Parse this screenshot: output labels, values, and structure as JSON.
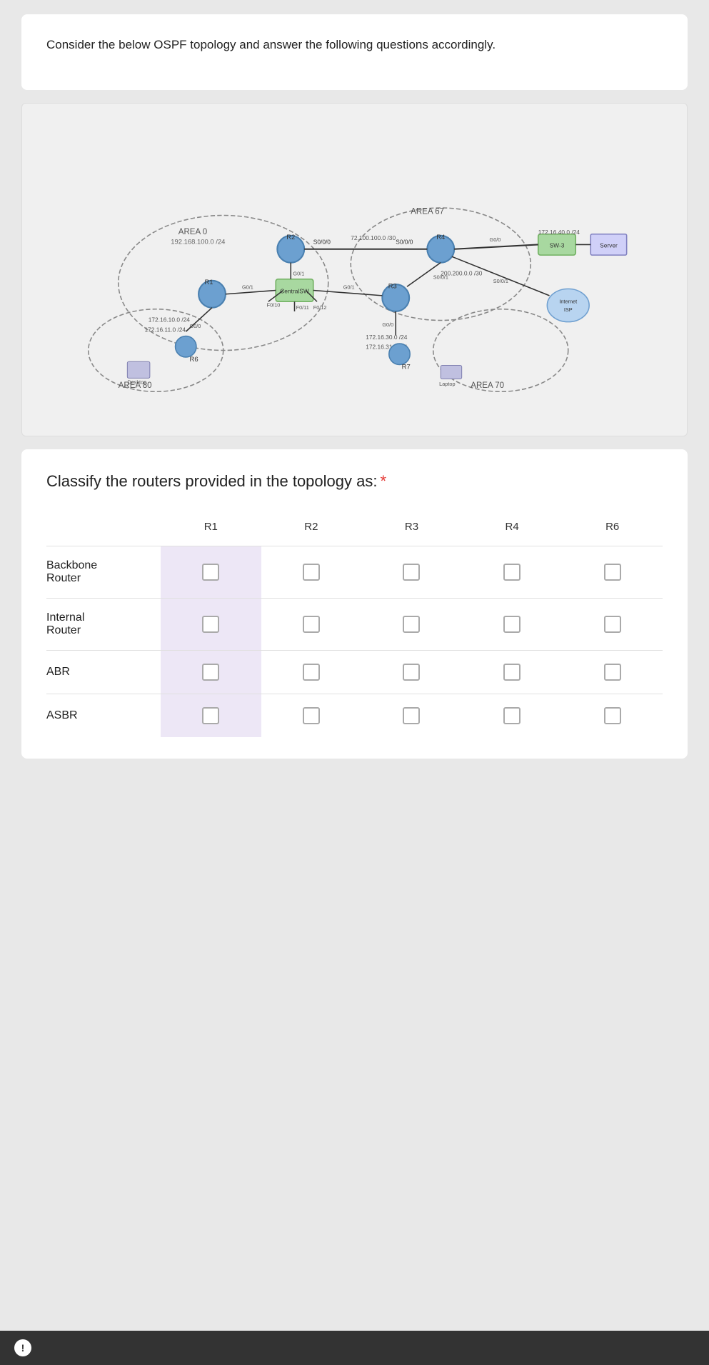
{
  "question": {
    "text": "Consider the below OSPF topology and answer the following questions accordingly.",
    "classify_title": "Classify the routers provided in the topology as:",
    "required_star": "*"
  },
  "table": {
    "columns": [
      "",
      "R1",
      "R2",
      "R3",
      "R4",
      "R6"
    ],
    "rows": [
      {
        "label": "Backbone Router",
        "id": "backbone"
      },
      {
        "label": "Internal Router",
        "id": "internal"
      },
      {
        "label": "ABR",
        "id": "abr"
      },
      {
        "label": "ASBR",
        "id": "asbr"
      }
    ]
  },
  "topology": {
    "areas": [
      "AREA 0",
      "AREA 67",
      "AREA 70",
      "AREA 80"
    ],
    "labels": {
      "r1": "R1",
      "r2": "R2",
      "r3": "R3",
      "r4": "R4",
      "r6": "R6",
      "r7": "R7",
      "centralSW": "CentralSW",
      "sw3": "SW-3",
      "server": "Server",
      "internet": "Internet",
      "isp": "ISP",
      "desktop": "Desktop",
      "laptop": "Laptop"
    }
  },
  "alert": {
    "icon": "!",
    "text": ""
  }
}
